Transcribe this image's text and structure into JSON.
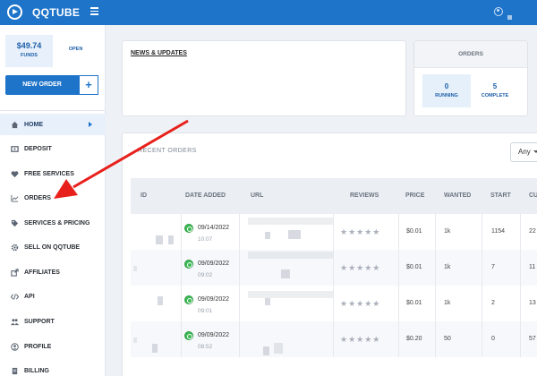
{
  "topbar": {
    "brand": "QQTUBE",
    "logo_icon": "play-circle-logo-icon",
    "menu_icon": "hamburger-menu-icon",
    "user_icon": "user-account-icon",
    "color": "#1e74c9"
  },
  "sidebar": {
    "funds_amount": "$49.74",
    "funds_label": "FUNDS",
    "open_label": "OPEN",
    "new_order_label": "NEW ORDER",
    "plus_label": "+",
    "items": [
      {
        "label": "HOME",
        "icon": "home-icon",
        "active": true
      },
      {
        "label": "DEPOSIT",
        "icon": "wallet-icon"
      },
      {
        "label": "FREE SERVICES",
        "icon": "heart-icon"
      },
      {
        "label": "ORDERS",
        "icon": "chart-line-icon"
      },
      {
        "label": "SERVICES & PRICING",
        "icon": "tags-icon"
      },
      {
        "label": "SELL ON QQTUBE",
        "icon": "gear-icon"
      },
      {
        "label": "AFFILIATES",
        "icon": "share-icon"
      },
      {
        "label": "API",
        "icon": "code-icon"
      },
      {
        "label": "SUPPORT",
        "icon": "people-icon"
      },
      {
        "label": "PROFILE",
        "icon": "user-circle-icon"
      },
      {
        "label": "BILLING",
        "icon": "receipt-icon"
      }
    ]
  },
  "news": {
    "title": "NEWS & UPDATES"
  },
  "orders_summary": {
    "title": "ORDERS",
    "running_count": "0",
    "running_label": "RUNNING",
    "complete_count": "5",
    "complete_label": "COMPLETE"
  },
  "recent_orders": {
    "title": "RECENT ORDERS",
    "filter_value": "Any",
    "columns": [
      "ID",
      "DATE ADDED",
      "URL",
      "REVIEWS",
      "PRICE",
      "WANTED",
      "START",
      "CU"
    ],
    "rows": [
      {
        "date": "09/14/2022",
        "time": "10:07",
        "price": "$0.01",
        "wanted": "1k",
        "start": "1154",
        "current": "22"
      },
      {
        "date": "09/09/2022",
        "time": "09:02",
        "price": "$0.01",
        "wanted": "1k",
        "start": "7",
        "current": "11"
      },
      {
        "date": "09/09/2022",
        "time": "09:01",
        "price": "$0.01",
        "wanted": "1k",
        "start": "2",
        "current": "13"
      },
      {
        "date": "09/09/2022",
        "time": "08:52",
        "price": "$0.20",
        "wanted": "50",
        "start": "0",
        "current": "57"
      }
    ],
    "stars": "★★★★★",
    "status_icon": "check-circle-icon"
  },
  "annotation": {
    "arrow_color": "#e8201c",
    "arrow_icon": "red-arrow-pointing-to-orders-icon"
  }
}
